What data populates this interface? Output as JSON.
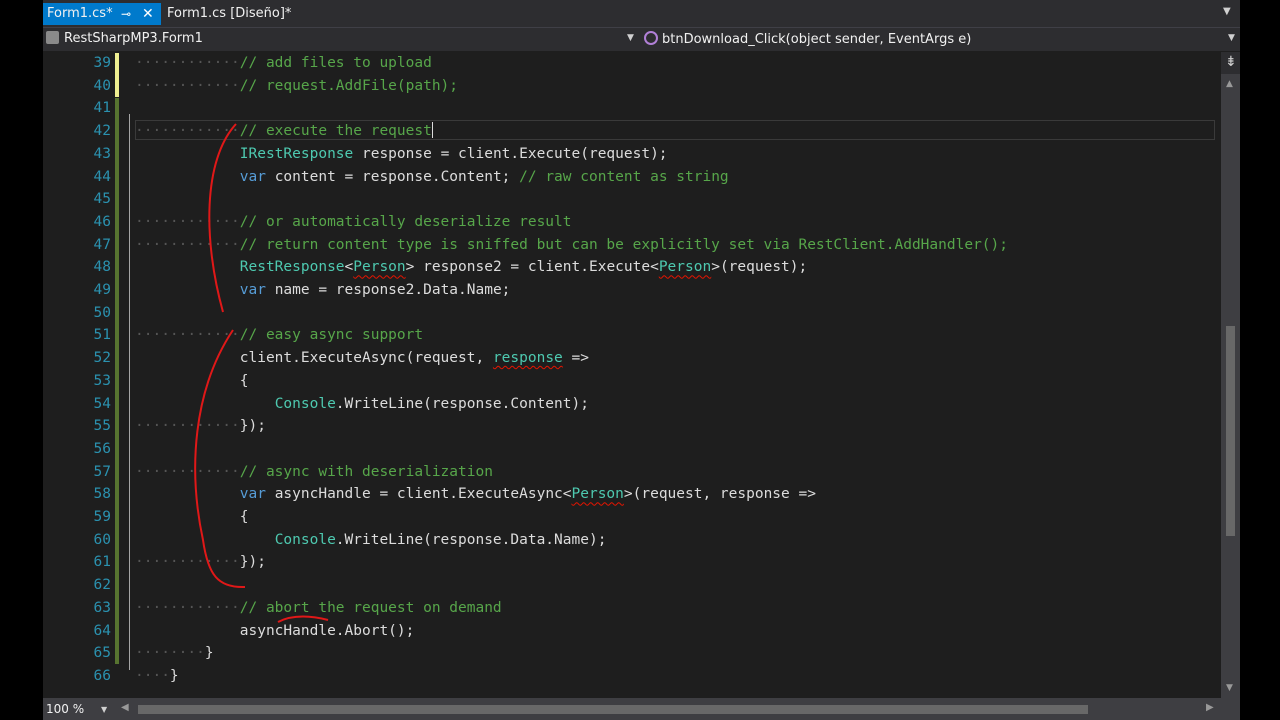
{
  "tabs": {
    "active_label": "Form1.cs*",
    "design_label": "Form1.cs [Diseño]*"
  },
  "navbar": {
    "type_scope": "RestSharpMP3.Form1",
    "member_scope": "btnDownload_Click(object sender, EventArgs e)"
  },
  "zoom": "100 %",
  "code_lines": [
    {
      "n": "39",
      "t": [
        [
          "ws",
          "············"
        ],
        [
          "cm",
          "// add files to upload"
        ]
      ]
    },
    {
      "n": "40",
      "t": [
        [
          "ws",
          "············"
        ],
        [
          "cm",
          "// request.AddFile(path);"
        ]
      ]
    },
    {
      "n": "41",
      "t": []
    },
    {
      "n": "42",
      "t": [
        [
          "ws",
          "············"
        ],
        [
          "cm",
          "// execute the request"
        ]
      ],
      "current": true
    },
    {
      "n": "43",
      "t": [
        [
          "ws",
          "            "
        ],
        [
          "ty",
          "IRestResponse"
        ],
        [
          "pl",
          " response = client.Execute(request);"
        ]
      ]
    },
    {
      "n": "44",
      "t": [
        [
          "ws",
          "            "
        ],
        [
          "kw",
          "var"
        ],
        [
          "pl",
          " content = response.Content; "
        ],
        [
          "cm",
          "// raw content as string"
        ]
      ]
    },
    {
      "n": "45",
      "t": []
    },
    {
      "n": "46",
      "t": [
        [
          "ws",
          "············"
        ],
        [
          "cm",
          "// or automatically deserialize result"
        ]
      ]
    },
    {
      "n": "47",
      "t": [
        [
          "ws",
          "············"
        ],
        [
          "cm",
          "// return content type is sniffed but can be explicitly set via RestClient.AddHandler();"
        ]
      ]
    },
    {
      "n": "48",
      "t": [
        [
          "ws",
          "            "
        ],
        [
          "ty",
          "RestResponse"
        ],
        [
          "pl",
          "<"
        ],
        [
          "sq",
          "Person"
        ],
        [
          "pl",
          "> response2 = client.Execute<"
        ],
        [
          "sq",
          "Person"
        ],
        [
          "pl",
          ">(request);"
        ]
      ]
    },
    {
      "n": "49",
      "t": [
        [
          "ws",
          "            "
        ],
        [
          "kw",
          "var"
        ],
        [
          "pl",
          " name = response2.Data.Name;"
        ]
      ]
    },
    {
      "n": "50",
      "t": []
    },
    {
      "n": "51",
      "t": [
        [
          "ws",
          "············"
        ],
        [
          "cm",
          "// easy async support"
        ]
      ]
    },
    {
      "n": "52",
      "t": [
        [
          "ws",
          "            "
        ],
        [
          "pl",
          "client.ExecuteAsync(request, "
        ],
        [
          "sq",
          "response"
        ],
        [
          "pl",
          " =>"
        ]
      ]
    },
    {
      "n": "53",
      "t": [
        [
          "ws",
          "            "
        ],
        [
          "pl",
          "{"
        ]
      ]
    },
    {
      "n": "54",
      "t": [
        [
          "ws",
          "                "
        ],
        [
          "ty",
          "Console"
        ],
        [
          "pl",
          ".WriteLine(response.Content);"
        ]
      ]
    },
    {
      "n": "55",
      "t": [
        [
          "ws",
          "············"
        ],
        [
          "pl",
          "});"
        ]
      ]
    },
    {
      "n": "56",
      "t": []
    },
    {
      "n": "57",
      "t": [
        [
          "ws",
          "············"
        ],
        [
          "cm",
          "// async with deserialization"
        ]
      ]
    },
    {
      "n": "58",
      "t": [
        [
          "ws",
          "            "
        ],
        [
          "kw",
          "var"
        ],
        [
          "pl",
          " asyncHandle = client.ExecuteAsync<"
        ],
        [
          "sq",
          "Person"
        ],
        [
          "pl",
          ">(request, response =>"
        ]
      ]
    },
    {
      "n": "59",
      "t": [
        [
          "ws",
          "            "
        ],
        [
          "pl",
          "{"
        ]
      ]
    },
    {
      "n": "60",
      "t": [
        [
          "ws",
          "                "
        ],
        [
          "ty",
          "Console"
        ],
        [
          "pl",
          ".WriteLine(response.Data.Name);"
        ]
      ]
    },
    {
      "n": "61",
      "t": [
        [
          "ws",
          "············"
        ],
        [
          "pl",
          "});"
        ]
      ]
    },
    {
      "n": "62",
      "t": []
    },
    {
      "n": "63",
      "t": [
        [
          "ws",
          "············"
        ],
        [
          "cm",
          "// abort the request on demand"
        ]
      ]
    },
    {
      "n": "64",
      "t": [
        [
          "ws",
          "            "
        ],
        [
          "pl",
          "asyncHandle.Abort();"
        ]
      ]
    },
    {
      "n": "65",
      "t": [
        [
          "ws",
          "········"
        ],
        [
          "pl",
          "}"
        ]
      ]
    },
    {
      "n": "66",
      "t": [
        [
          "ws",
          "····"
        ],
        [
          "pl",
          "}"
        ]
      ]
    }
  ],
  "colors": {
    "editor_bg": "#1e1e1e",
    "comment": "#57a64a",
    "keyword": "#569cd6",
    "type": "#4ec9b0",
    "line_number": "#2b91af",
    "active_tab": "#007acc",
    "annotation_ink": "#e01818"
  },
  "icons": [
    "pin-icon",
    "close-icon",
    "class-icon",
    "method-icon",
    "dropdown-icon",
    "split-icon"
  ]
}
